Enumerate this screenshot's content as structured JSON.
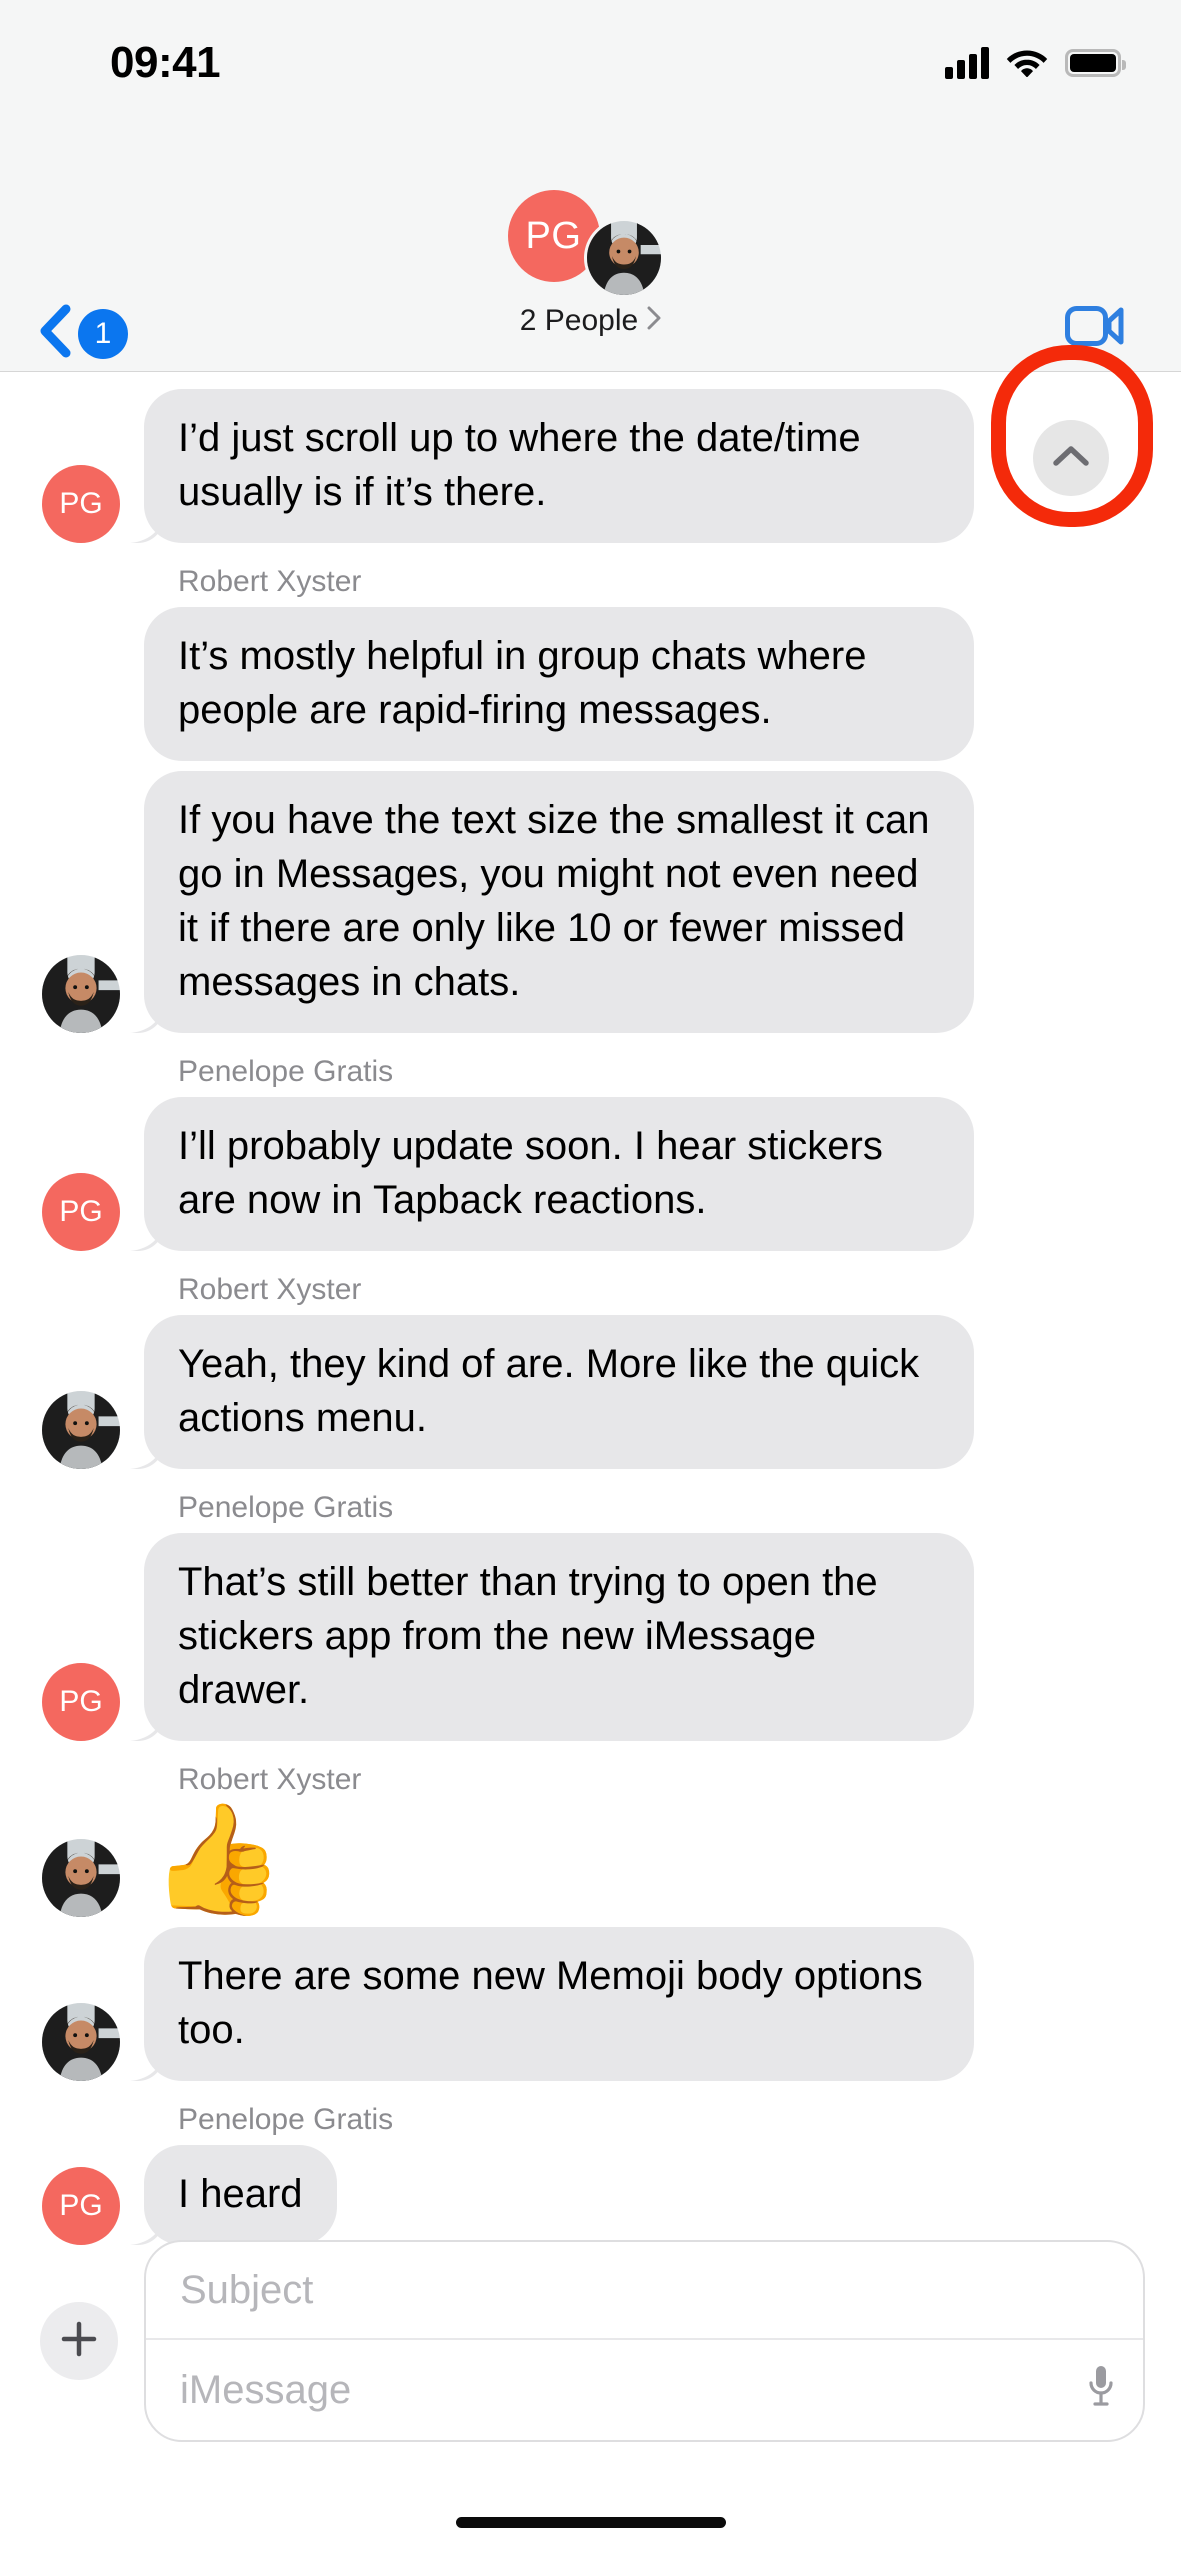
{
  "status_bar": {
    "time": "09:41",
    "cellular_icon": "signal-bars-icon",
    "wifi_icon": "wifi-icon",
    "battery_icon": "battery-full-icon"
  },
  "nav_bar": {
    "back_icon": "chevron-left-icon",
    "back_badge_count": "1",
    "avatar_initials": "PG",
    "avatar_photo_alt": "Robert Xyster",
    "subtitle": "2 People",
    "subtitle_chevron_icon": "chevron-right-icon",
    "facetime_icon": "video-camera-icon"
  },
  "scroll_up_button": {
    "icon": "chevron-up-icon",
    "highlight_color": "#f42a0a",
    "button_color": "#e6e6e6"
  },
  "colors": {
    "bubble_incoming": "#e7e7e9",
    "avatar_pg": "#f4685f",
    "accent_blue": "#0b76ef",
    "nav_background": "#f5f6f6",
    "sender_label": "#8b8b8f"
  },
  "conversation": [
    {
      "type": "message",
      "sender": "Penelope Gratis",
      "avatar": "PG",
      "show_label": false,
      "show_avatar": true,
      "tail": true,
      "text": "I’d just scroll up to where the date/time usually is if it’s there."
    },
    {
      "type": "label",
      "text": "Robert Xyster"
    },
    {
      "type": "message",
      "sender": "Robert Xyster",
      "avatar": "photo",
      "show_avatar": false,
      "tail": false,
      "text": "It’s mostly helpful in group chats where people are rapid-firing messages."
    },
    {
      "type": "message",
      "sender": "Robert Xyster",
      "avatar": "photo",
      "show_avatar": true,
      "tail": true,
      "text": "If you have the text size the smallest it can go in Messages, you might not even need it if there are only like 10 or fewer missed messages in chats."
    },
    {
      "type": "label",
      "text": "Penelope Gratis"
    },
    {
      "type": "message",
      "sender": "Penelope Gratis",
      "avatar": "PG",
      "show_avatar": true,
      "tail": true,
      "text": "I’ll probably update soon. I hear stickers are now in Tapback reactions."
    },
    {
      "type": "label",
      "text": "Robert Xyster"
    },
    {
      "type": "message",
      "sender": "Robert Xyster",
      "avatar": "photo",
      "show_avatar": true,
      "tail": true,
      "text": "Yeah, they kind of are. More like the quick actions menu."
    },
    {
      "type": "label",
      "text": "Penelope Gratis"
    },
    {
      "type": "message",
      "sender": "Penelope Gratis",
      "avatar": "PG",
      "show_avatar": true,
      "tail": true,
      "text": "That’s still better than trying to open the stickers app from the new iMessage drawer."
    },
    {
      "type": "label",
      "text": "Robert Xyster"
    },
    {
      "type": "emoji",
      "sender": "Robert Xyster",
      "avatar": "photo",
      "show_avatar": true,
      "text": "👍"
    },
    {
      "type": "message",
      "sender": "Robert Xyster",
      "avatar": "photo",
      "show_avatar": true,
      "tail": true,
      "text": "There are some new Memoji body options too."
    },
    {
      "type": "label",
      "text": "Penelope Gratis"
    },
    {
      "type": "message",
      "sender": "Penelope Gratis",
      "avatar": "PG",
      "show_avatar": true,
      "tail": true,
      "text": "I heard"
    }
  ],
  "input_bar": {
    "plus_icon": "plus-icon",
    "subject_placeholder": "Subject",
    "imessage_placeholder": "iMessage",
    "mic_icon": "microphone-icon"
  }
}
